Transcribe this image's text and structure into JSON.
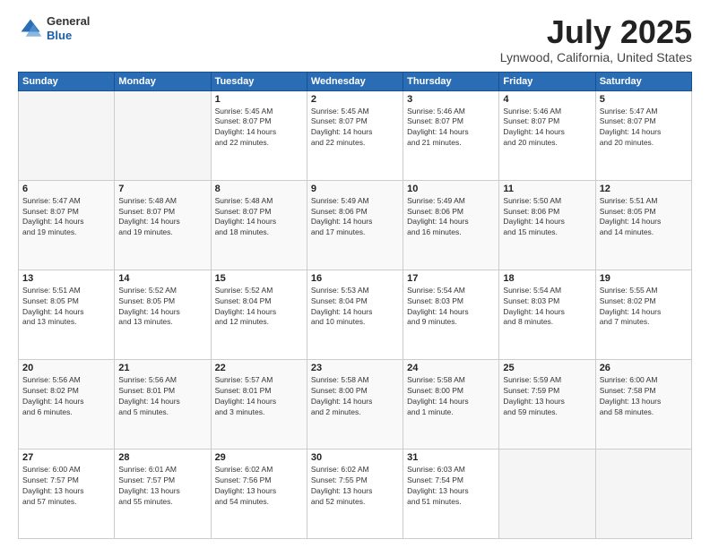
{
  "logo": {
    "general": "General",
    "blue": "Blue"
  },
  "header": {
    "title": "July 2025",
    "subtitle": "Lynwood, California, United States"
  },
  "weekdays": [
    "Sunday",
    "Monday",
    "Tuesday",
    "Wednesday",
    "Thursday",
    "Friday",
    "Saturday"
  ],
  "weeks": [
    [
      {
        "day": "",
        "info": ""
      },
      {
        "day": "",
        "info": ""
      },
      {
        "day": "1",
        "info": "Sunrise: 5:45 AM\nSunset: 8:07 PM\nDaylight: 14 hours\nand 22 minutes."
      },
      {
        "day": "2",
        "info": "Sunrise: 5:45 AM\nSunset: 8:07 PM\nDaylight: 14 hours\nand 22 minutes."
      },
      {
        "day": "3",
        "info": "Sunrise: 5:46 AM\nSunset: 8:07 PM\nDaylight: 14 hours\nand 21 minutes."
      },
      {
        "day": "4",
        "info": "Sunrise: 5:46 AM\nSunset: 8:07 PM\nDaylight: 14 hours\nand 20 minutes."
      },
      {
        "day": "5",
        "info": "Sunrise: 5:47 AM\nSunset: 8:07 PM\nDaylight: 14 hours\nand 20 minutes."
      }
    ],
    [
      {
        "day": "6",
        "info": "Sunrise: 5:47 AM\nSunset: 8:07 PM\nDaylight: 14 hours\nand 19 minutes."
      },
      {
        "day": "7",
        "info": "Sunrise: 5:48 AM\nSunset: 8:07 PM\nDaylight: 14 hours\nand 19 minutes."
      },
      {
        "day": "8",
        "info": "Sunrise: 5:48 AM\nSunset: 8:07 PM\nDaylight: 14 hours\nand 18 minutes."
      },
      {
        "day": "9",
        "info": "Sunrise: 5:49 AM\nSunset: 8:06 PM\nDaylight: 14 hours\nand 17 minutes."
      },
      {
        "day": "10",
        "info": "Sunrise: 5:49 AM\nSunset: 8:06 PM\nDaylight: 14 hours\nand 16 minutes."
      },
      {
        "day": "11",
        "info": "Sunrise: 5:50 AM\nSunset: 8:06 PM\nDaylight: 14 hours\nand 15 minutes."
      },
      {
        "day": "12",
        "info": "Sunrise: 5:51 AM\nSunset: 8:05 PM\nDaylight: 14 hours\nand 14 minutes."
      }
    ],
    [
      {
        "day": "13",
        "info": "Sunrise: 5:51 AM\nSunset: 8:05 PM\nDaylight: 14 hours\nand 13 minutes."
      },
      {
        "day": "14",
        "info": "Sunrise: 5:52 AM\nSunset: 8:05 PM\nDaylight: 14 hours\nand 13 minutes."
      },
      {
        "day": "15",
        "info": "Sunrise: 5:52 AM\nSunset: 8:04 PM\nDaylight: 14 hours\nand 12 minutes."
      },
      {
        "day": "16",
        "info": "Sunrise: 5:53 AM\nSunset: 8:04 PM\nDaylight: 14 hours\nand 10 minutes."
      },
      {
        "day": "17",
        "info": "Sunrise: 5:54 AM\nSunset: 8:03 PM\nDaylight: 14 hours\nand 9 minutes."
      },
      {
        "day": "18",
        "info": "Sunrise: 5:54 AM\nSunset: 8:03 PM\nDaylight: 14 hours\nand 8 minutes."
      },
      {
        "day": "19",
        "info": "Sunrise: 5:55 AM\nSunset: 8:02 PM\nDaylight: 14 hours\nand 7 minutes."
      }
    ],
    [
      {
        "day": "20",
        "info": "Sunrise: 5:56 AM\nSunset: 8:02 PM\nDaylight: 14 hours\nand 6 minutes."
      },
      {
        "day": "21",
        "info": "Sunrise: 5:56 AM\nSunset: 8:01 PM\nDaylight: 14 hours\nand 5 minutes."
      },
      {
        "day": "22",
        "info": "Sunrise: 5:57 AM\nSunset: 8:01 PM\nDaylight: 14 hours\nand 3 minutes."
      },
      {
        "day": "23",
        "info": "Sunrise: 5:58 AM\nSunset: 8:00 PM\nDaylight: 14 hours\nand 2 minutes."
      },
      {
        "day": "24",
        "info": "Sunrise: 5:58 AM\nSunset: 8:00 PM\nDaylight: 14 hours\nand 1 minute."
      },
      {
        "day": "25",
        "info": "Sunrise: 5:59 AM\nSunset: 7:59 PM\nDaylight: 13 hours\nand 59 minutes."
      },
      {
        "day": "26",
        "info": "Sunrise: 6:00 AM\nSunset: 7:58 PM\nDaylight: 13 hours\nand 58 minutes."
      }
    ],
    [
      {
        "day": "27",
        "info": "Sunrise: 6:00 AM\nSunset: 7:57 PM\nDaylight: 13 hours\nand 57 minutes."
      },
      {
        "day": "28",
        "info": "Sunrise: 6:01 AM\nSunset: 7:57 PM\nDaylight: 13 hours\nand 55 minutes."
      },
      {
        "day": "29",
        "info": "Sunrise: 6:02 AM\nSunset: 7:56 PM\nDaylight: 13 hours\nand 54 minutes."
      },
      {
        "day": "30",
        "info": "Sunrise: 6:02 AM\nSunset: 7:55 PM\nDaylight: 13 hours\nand 52 minutes."
      },
      {
        "day": "31",
        "info": "Sunrise: 6:03 AM\nSunset: 7:54 PM\nDaylight: 13 hours\nand 51 minutes."
      },
      {
        "day": "",
        "info": ""
      },
      {
        "day": "",
        "info": ""
      }
    ]
  ]
}
